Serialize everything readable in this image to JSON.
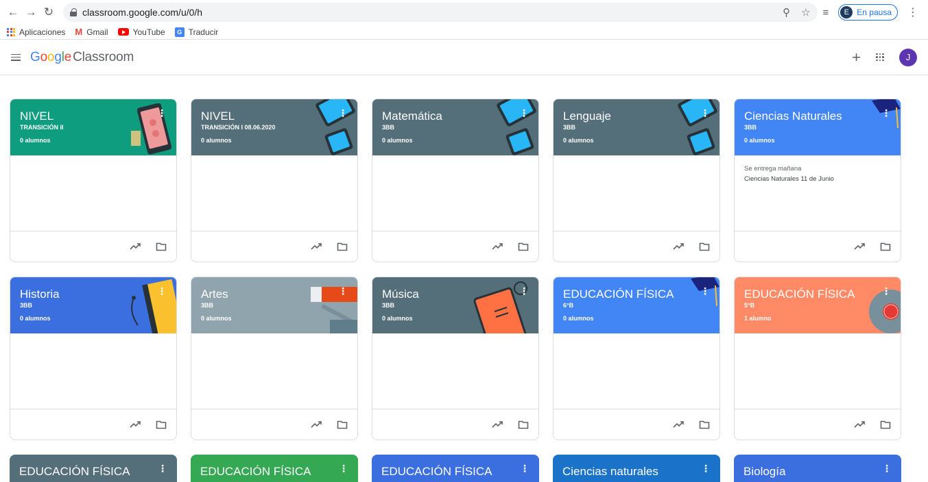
{
  "browser": {
    "url": "classroom.google.com/u/0/h",
    "profile_initial": "E",
    "profile_status": "En pausa"
  },
  "bookmarks": [
    {
      "label": "Aplicaciones",
      "icon": "apps-grid-icon"
    },
    {
      "label": "Gmail",
      "icon": "gmail-icon"
    },
    {
      "label": "YouTube",
      "icon": "youtube-icon"
    },
    {
      "label": "Traducir",
      "icon": "translate-icon"
    }
  ],
  "appbar": {
    "logo_google": [
      "G",
      "o",
      "o",
      "g",
      "l",
      "e"
    ],
    "logo_product": "Classroom",
    "avatar_initial": "J"
  },
  "classes": [
    {
      "title": "NIVEL",
      "section": "TRANSICIÓN II",
      "students": "0 alumnos",
      "color": "#0f9d7f",
      "deco": "tablet-red"
    },
    {
      "title": "NIVEL",
      "section": "TRANSICIÓN I 08.06.2020",
      "students": "0 alumnos",
      "color": "#546e7a",
      "deco": "tablets-blue"
    },
    {
      "title": "Matemática",
      "section": "3BB",
      "students": "0 alumnos",
      "color": "#546e7a",
      "deco": "tablets-blue"
    },
    {
      "title": "Lenguaje",
      "section": "3BB",
      "students": "0 alumnos",
      "color": "#546e7a",
      "deco": "tablets-blue"
    },
    {
      "title": "Ciencias Naturales",
      "section": "3BB",
      "students": "0 alumnos",
      "color": "#4285f4",
      "deco": "cap",
      "due_label": "Se entrega mañana",
      "due_item": "Ciencias Naturales 11 de Junio"
    },
    {
      "title": "Historia",
      "section": "3BB",
      "students": "0 alumnos",
      "color": "#3b6fe0",
      "deco": "books-yellow"
    },
    {
      "title": "Artes",
      "section": "3BB",
      "students": "0 alumnos",
      "color": "#90a4ae",
      "deco": "paint"
    },
    {
      "title": "Música",
      "section": "3BB",
      "students": "0 alumnos",
      "color": "#546e7a",
      "deco": "book-orange"
    },
    {
      "title": "EDUCACIÓN FÍSICA",
      "section": "6°B",
      "students": "0 alumnos",
      "color": "#4285f4",
      "deco": "cap"
    },
    {
      "title": "EDUCACIÓN FÍSICA",
      "section": "5°B",
      "students": "1 alumno",
      "color": "#ff8a65",
      "deco": "disc"
    }
  ],
  "partial_classes": [
    {
      "title": "EDUCACIÓN FÍSICA",
      "color": "#546e7a"
    },
    {
      "title": "EDUCACIÓN FÍSICA",
      "color": "#34a853"
    },
    {
      "title": "EDUCACIÓN FÍSICA",
      "color": "#3b6fe0"
    },
    {
      "title": "Ciencias naturales",
      "color": "#1a73c8"
    },
    {
      "title": "Biología",
      "color": "#3b6fe0"
    }
  ]
}
